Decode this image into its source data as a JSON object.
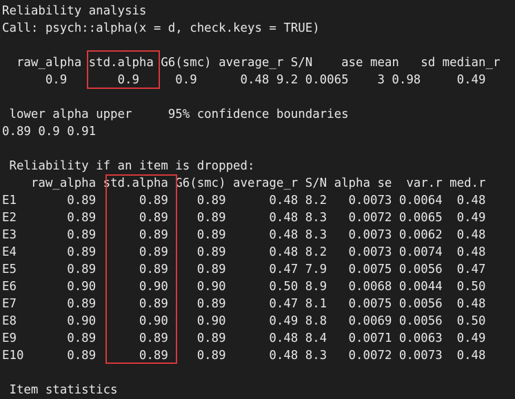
{
  "console": {
    "title": "Reliability analysis",
    "call": "Call: psych::alpha(x = d, check.keys = TRUE)",
    "summary": {
      "header": "  raw_alpha std.alpha G6(smc) average_r S/N    ase mean   sd median_r",
      "values": "      0.9       0.9     0.9      0.48 9.2 0.0065    3 0.98     0.49"
    },
    "confidence": {
      "header": " lower alpha upper     95% confidence boundaries",
      "values": "0.89 0.9 0.91"
    },
    "dropped": {
      "title": " Reliability if an item is dropped:",
      "header": "    raw_alpha std.alpha G6(smc) average_r S/N alpha se  var.r med.r",
      "rows": [
        "E1       0.89      0.89    0.89      0.48 8.2   0.0073 0.0064  0.48",
        "E2       0.89      0.89    0.89      0.48 8.3   0.0072 0.0065  0.49",
        "E3       0.89      0.89    0.89      0.48 8.3   0.0073 0.0062  0.48",
        "E4       0.89      0.89    0.89      0.48 8.2   0.0073 0.0074  0.48",
        "E5       0.89      0.89    0.89      0.47 7.9   0.0075 0.0056  0.47",
        "E6       0.90      0.90    0.90      0.50 8.9   0.0068 0.0044  0.50",
        "E7       0.89      0.89    0.89      0.47 8.1   0.0075 0.0056  0.48",
        "E8       0.90      0.90    0.90      0.49 8.8   0.0069 0.0056  0.50",
        "E9       0.89      0.89    0.89      0.48 8.4   0.0071 0.0063  0.49",
        "E10      0.89      0.89    0.89      0.48 8.3   0.0072 0.0073  0.48"
      ]
    },
    "item_statistics_title": " Item statistics"
  },
  "colors": {
    "background": "#1e1e1e",
    "text": "#e8e8e8",
    "highlight_border": "#d9383b"
  }
}
